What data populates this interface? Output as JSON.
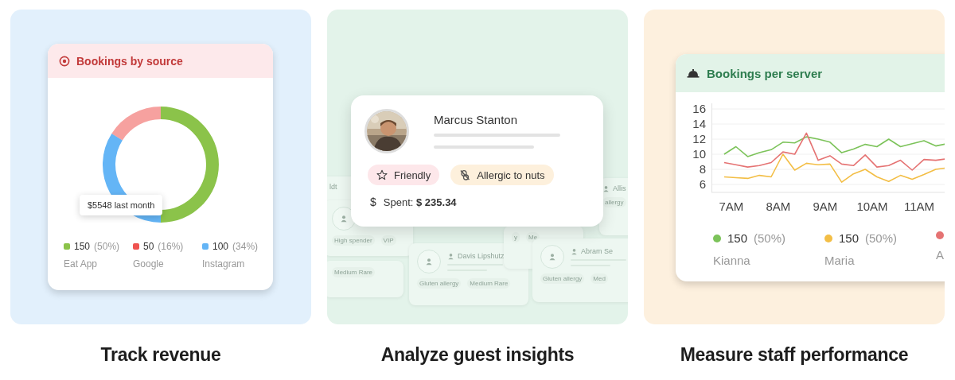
{
  "revenue_panel": {
    "caption": "Track revenue",
    "card": {
      "title": "Bookings by source",
      "tooltip": "$5548 last month",
      "chart_data": {
        "type": "donut",
        "categories": [
          "Eat App",
          "Google",
          "Instagram"
        ],
        "values": [
          50,
          16,
          34
        ]
      },
      "legend": [
        {
          "value": "150",
          "percent": "(50%)",
          "color": "#8bc34a"
        },
        {
          "value": "50",
          "percent": "(16%)",
          "color": "#ef5350"
        },
        {
          "value": "100",
          "percent": "(34%)",
          "color": "#64b5f6"
        }
      ]
    }
  },
  "guests_panel": {
    "caption": "Analyze guest insights",
    "guest": {
      "name": "Marcus Stanton",
      "tags": [
        {
          "label": "Friendly",
          "kind": "star"
        },
        {
          "label": "Allergic to nuts",
          "kind": "allergy"
        }
      ],
      "spent_icon": "$",
      "spent": "Spent: **$ 235.34**"
    },
    "background_cards": [
      {
        "name": "ldt",
        "person_icon": false,
        "avatar": false
      },
      {
        "avatar": true,
        "chips": [
          "High spender",
          "VIP"
        ]
      },
      {
        "avatar": false,
        "chips": [
          "Medium Rare"
        ]
      },
      {
        "name": "Davis Lipshutz",
        "person_icon": true,
        "avatar": true,
        "chips": [
          "Gluten allergy",
          "Medium Rare"
        ]
      },
      {
        "avatar": false,
        "chips": [
          "y",
          "Me"
        ]
      },
      {
        "name": "Abram Se",
        "person_icon": true,
        "avatar": true,
        "chips": [
          "Gluten allergy",
          "Med"
        ]
      },
      {
        "name": "Allis",
        "person_icon": true,
        "avatar": false,
        "chips": [
          "allergy"
        ]
      }
    ]
  },
  "staff_panel": {
    "caption": "Measure staff performance",
    "card": {
      "title": "Bookings per server",
      "chart_data": {
        "type": "line",
        "x": [
          6.85,
          7.1,
          7.35,
          7.6,
          7.85,
          8.1,
          8.35,
          8.6,
          8.85,
          9.1,
          9.35,
          9.6,
          9.85,
          10.1,
          10.35,
          10.6,
          10.85,
          11.1,
          11.35,
          11.6
        ],
        "xlim": [
          6.58,
          12.59
        ],
        "ylim": [
          4.9,
          16.7
        ],
        "grid": true,
        "legend": true,
        "xticks": [
          {
            "value": 7,
            "label": "7AM"
          },
          {
            "value": 8,
            "label": "8AM"
          },
          {
            "value": 9,
            "label": "9AM"
          },
          {
            "value": 10,
            "label": "10AM"
          },
          {
            "value": 11,
            "label": "11AM"
          }
        ],
        "yticks": [
          6,
          8,
          10,
          12,
          14,
          16
        ],
        "series": [
          {
            "name": "Kianna",
            "color": "#7cc35a",
            "values": [
              10,
              11,
              9.7,
              10.2,
              10.6,
              11.6,
              11.5,
              12.3,
              12,
              11.6,
              10.2,
              10.7,
              11.3,
              11,
              12,
              11,
              11.4,
              11.8,
              11.1,
              11.4
            ]
          },
          {
            "name": "Maria",
            "color": "#f3be45",
            "values": [
              7,
              6.9,
              6.8,
              7.2,
              7,
              10,
              7.9,
              8.8,
              8.6,
              8.7,
              6.3,
              7.4,
              8,
              7,
              6.4,
              7.2,
              6.7,
              7.3,
              8,
              8.2
            ]
          },
          {
            "name": "A",
            "color": "#e57373",
            "values": [
              8.9,
              8.6,
              8.3,
              8.5,
              8.9,
              10.3,
              10,
              12.8,
              9.2,
              9.8,
              8.7,
              8.5,
              9.9,
              8.3,
              8.5,
              9.2,
              7.9,
              9.3,
              9.2,
              9.4
            ]
          }
        ]
      },
      "legend": [
        {
          "value": "150",
          "percent": "(50%)"
        },
        {
          "value": "150",
          "percent": "(50%)"
        }
      ]
    }
  }
}
